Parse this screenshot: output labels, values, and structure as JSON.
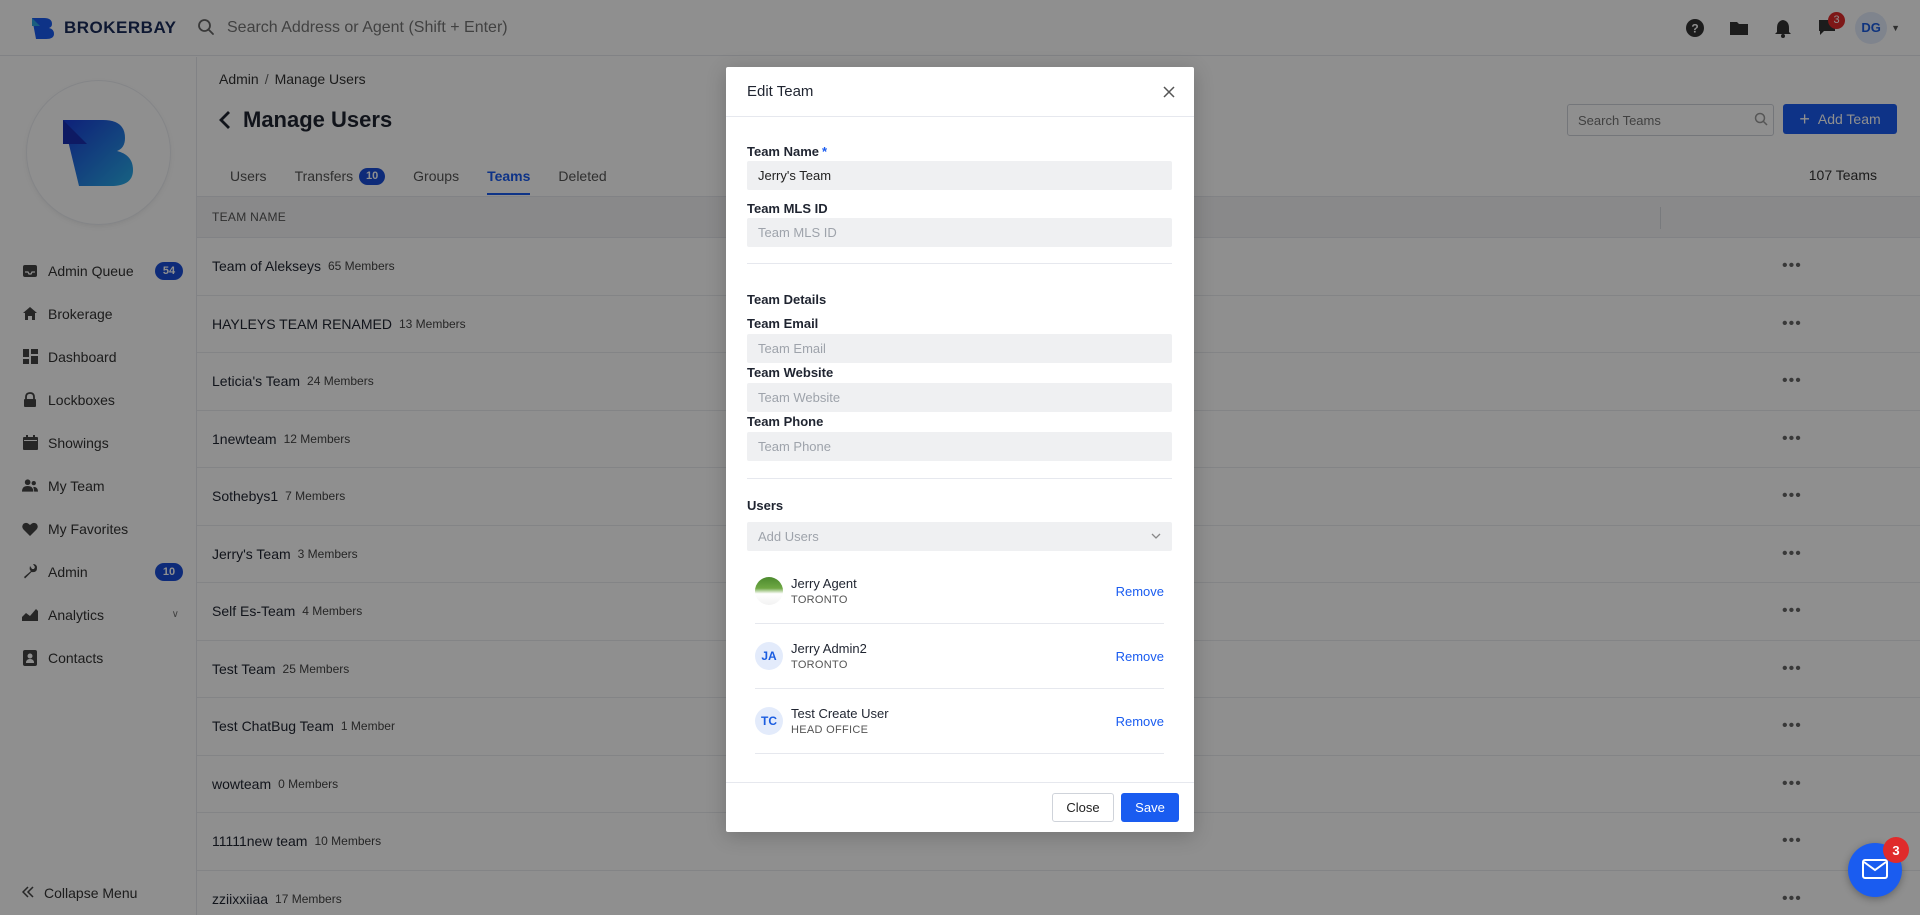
{
  "topbar": {
    "brand": "BROKERBAY",
    "search_placeholder": "Search Address or Agent (Shift + Enter)",
    "icons": [
      "help-icon",
      "folder-icon",
      "bell-icon",
      "chat-icon"
    ],
    "message_badge": "3",
    "avatar_initials": "DG"
  },
  "sidebar": {
    "items": [
      {
        "label": "Admin Queue",
        "icon": "inbox-icon",
        "badge": "54"
      },
      {
        "label": "Brokerage",
        "icon": "home-icon"
      },
      {
        "label": "Dashboard",
        "icon": "dashboard-icon"
      },
      {
        "label": "Lockboxes",
        "icon": "lock-icon"
      },
      {
        "label": "Showings",
        "icon": "calendar-icon"
      },
      {
        "label": "My Team",
        "icon": "team-icon"
      },
      {
        "label": "My Favorites",
        "icon": "heart-icon"
      },
      {
        "label": "Admin",
        "icon": "wrench-icon",
        "badge": "10"
      },
      {
        "label": "Analytics",
        "icon": "chart-icon"
      },
      {
        "label": "Contacts",
        "icon": "contact-icon"
      }
    ],
    "collapse_label": "Collapse Menu"
  },
  "main": {
    "breadcrumb": {
      "root": "Admin",
      "sep": "/",
      "current": "Manage Users"
    },
    "title": "Manage Users",
    "search_placeholder": "Search Teams",
    "add_team_label": "Add Team",
    "tabs": [
      {
        "label": "Users"
      },
      {
        "label": "Transfers",
        "badge": "10"
      },
      {
        "label": "Groups"
      },
      {
        "label": "Teams"
      },
      {
        "label": "Deleted"
      }
    ],
    "teams_count": "107 Teams",
    "column_header": "TEAM NAME",
    "rows": [
      {
        "name": "Team of Alekseys",
        "members": "65 Members"
      },
      {
        "name": "HAYLEYS TEAM RENAMED",
        "members": "13 Members"
      },
      {
        "name": "Leticia's Team",
        "members": "24 Members"
      },
      {
        "name": "1newteam",
        "members": "12 Members"
      },
      {
        "name": "Sothebys1",
        "members": "7 Members"
      },
      {
        "name": "Jerry's Team",
        "members": "3 Members"
      },
      {
        "name": "Self Es-Team",
        "members": "4 Members"
      },
      {
        "name": "Test Team",
        "members": "25 Members"
      },
      {
        "name": "Test ChatBug Team",
        "members": "1 Member"
      },
      {
        "name": "wowteam",
        "members": "0 Members"
      },
      {
        "name": "11111new team",
        "members": "10 Members"
      },
      {
        "name": "zziixxiiaa",
        "members": "17 Members"
      }
    ]
  },
  "modal": {
    "title": "Edit Team",
    "team_name_label": "Team Name",
    "required_mark": "*",
    "team_name_value": "Jerry's Team",
    "mls_label": "Team MLS ID",
    "mls_placeholder": "Team MLS ID",
    "details_title": "Team Details",
    "email_label": "Team Email",
    "email_placeholder": "Team Email",
    "website_label": "Team Website",
    "website_placeholder": "Team Website",
    "phone_label": "Team Phone",
    "phone_placeholder": "Team Phone",
    "users_title": "Users",
    "add_users_placeholder": "Add Users",
    "users": [
      {
        "name": "Jerry Agent",
        "office": "TORONTO",
        "initials": "",
        "remove": "Remove"
      },
      {
        "name": "Jerry Admin2",
        "office": "TORONTO",
        "initials": "JA",
        "remove": "Remove"
      },
      {
        "name": "Test Create User",
        "office": "HEAD OFFICE",
        "initials": "TC",
        "remove": "Remove"
      }
    ],
    "close_label": "Close",
    "save_label": "Save"
  },
  "chat_widget": {
    "badge": "3"
  },
  "colors": {
    "accent": "#1a5cf0",
    "badge": "#1a4ed8",
    "alert": "#e02b2b"
  }
}
